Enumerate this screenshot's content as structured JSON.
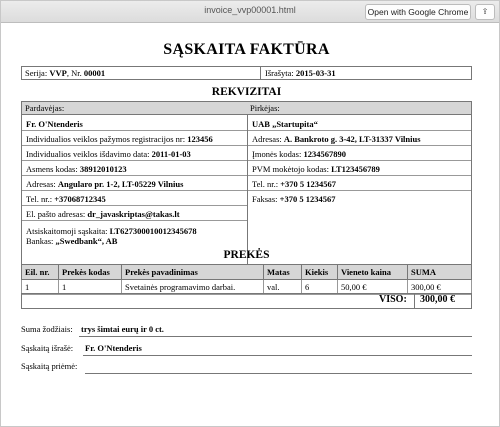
{
  "window": {
    "title": "invoice_vvp00001.html",
    "open_button": "Open with Google Chrome",
    "share_icon": "share-icon"
  },
  "invoice": {
    "title": "SĄSKAITA FAKTŪRA",
    "serija_label": "Serija:",
    "serija_value": "VVP",
    "nr_label": "Nr.",
    "nr_value": "00001",
    "israsyta_label": "Išrašyta:",
    "israsyta_value": "2015-03-31",
    "rekvizitai_title": "REKVIZITAI",
    "seller": {
      "header": "Pardavėjas:",
      "name": "Fr. O'Ntenderis",
      "reg_label": "Individualios veiklos pažymos registracijos nr:",
      "reg_value": "123456",
      "date_label": "Individualios veiklos išdavimo data:",
      "date_value": "2011-01-03",
      "code_label": "Asmens kodas:",
      "code_value": "38912010123",
      "addr_label": "Adresas:",
      "addr_value": "Angularo pr. 1-2, LT-05229 Vilnius",
      "tel_label": "Tel. nr.:",
      "tel_value": "+37068712345",
      "email_label": "El. pašto adresas:",
      "email_value": "dr_javaskriptas@takas.lt",
      "account_label": "Atsiskaitomoji sąskaita:",
      "account_value": "LT627300010012345678",
      "bank_label": "Bankas:",
      "bank_value": "„Swedbank“, AB"
    },
    "buyer": {
      "header": "Pirkėjas:",
      "name": "UAB „Startupita“",
      "addr_label": "Adresas:",
      "addr_value": "A. Bankroto g. 3-42, LT-31337 Vilnius",
      "company_label": "Įmonės kodas:",
      "company_value": "1234567890",
      "vat_label": "PVM mokėtojo kodas:",
      "vat_value": "LT123456789",
      "tel_label": "Tel. nr.:",
      "tel_value": "+370 5 1234567",
      "fax_label": "Faksas:",
      "fax_value": "+370 5 1234567"
    },
    "items_title": "PREKĖS",
    "columns": [
      "Eil. nr.",
      "Prekės kodas",
      "Prekės pavadinimas",
      "Matas",
      "Kiekis",
      "Vieneto kaina",
      "SUMA"
    ],
    "rows": [
      [
        "1",
        "1",
        "Svetainės programavimo darbai.",
        "val.",
        "6",
        "50,00 €",
        "300,00 €"
      ]
    ],
    "total_label": "VISO:",
    "total_value": "300,00 €",
    "words_label": "Suma žodžiais:",
    "words_value": "trys šimtai eurų ir 0 ct.",
    "issued_label": "Sąskaitą išrašė:",
    "issued_value": "Fr. O'Ntenderis",
    "received_label": "Sąskaitą priėmė:"
  }
}
